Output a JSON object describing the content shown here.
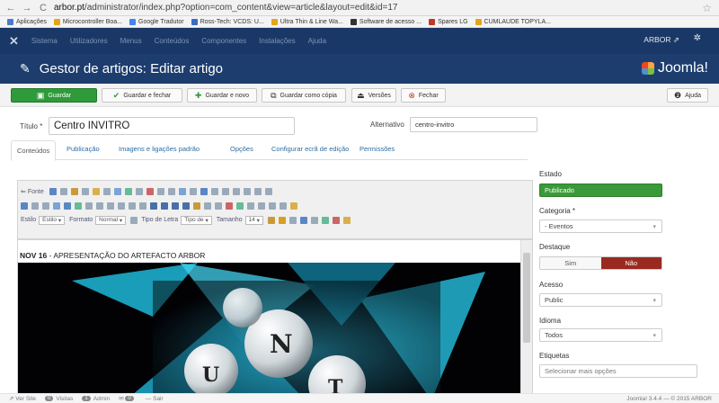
{
  "browser": {
    "url_prefix": "arbor.pt",
    "url_rest": "/administrator/index.php?option=com_content&view=article&layout=edit&id=17",
    "bookmarks": [
      {
        "label": "Aplicações",
        "color": "#4a7bd0"
      },
      {
        "label": "Microcontroller Boa...",
        "color": "#e6a419"
      },
      {
        "label": "Google Tradutor",
        "color": "#4285f4"
      },
      {
        "label": "Ross-Tech: VCDS: U...",
        "color": "#3b6cc4"
      },
      {
        "label": "Ultra Thin & Line Wa...",
        "color": "#e6a419"
      },
      {
        "label": "Software de acesso ...",
        "color": "#333333"
      },
      {
        "label": "Spares LG",
        "color": "#c0392b"
      },
      {
        "label": "CUMLAUDE TOPYLA...",
        "color": "#e6a419"
      }
    ]
  },
  "topnav": {
    "items": [
      "Sistema",
      "Utilizadores",
      "Menus",
      "Conteúdos",
      "Componentes",
      "Instalações",
      "Ajuda"
    ],
    "user": "ARBOR ⇗"
  },
  "header": {
    "title": "Gestor de artigos: Editar artigo",
    "logo": "Joomla!"
  },
  "toolbar": {
    "save": "Guardar",
    "save_close": "Guardar e fechar",
    "save_new": "Guardar e novo",
    "save_copy": "Guardar como cópia",
    "versions": "Versões",
    "close": "Fechar",
    "help": "Ajuda"
  },
  "form": {
    "title_label": "Título *",
    "title_value": "Centro INVITRO",
    "alias_label": "Alternativo",
    "alias_value": "centro-invitro"
  },
  "tabs": [
    "Conteúdos",
    "Publicação",
    "Imagens e ligações padrão",
    "Opções",
    "Configurar ecrã de edição",
    "Permissões"
  ],
  "editor": {
    "row1_label": "Fonte",
    "style_label": "Estilo",
    "style_value": "Estilo",
    "format_label": "Formato",
    "format_value": "Normal",
    "font_label": "Tipo de Letra",
    "font_value": "Tipo de",
    "size_label": "Tamanho",
    "size_value": "14",
    "heading_bold": "NOV 16",
    "heading_rest": " - APRESENTAÇÃO DO ARTEFACTO ARBOR"
  },
  "sidebar": {
    "estado_label": "Estado",
    "estado_value": "Publicado",
    "categoria_label": "Categoria *",
    "categoria_value": "- Eventos",
    "destaque_label": "Destaque",
    "sim": "Sim",
    "nao": "Não",
    "acesso_label": "Acesso",
    "acesso_value": "Public",
    "idioma_label": "Idioma",
    "idioma_value": "Todos",
    "etiquetas_label": "Etiquetas",
    "etiquetas_placeholder": "Selecionar mais opções"
  },
  "status": {
    "ver_site": "Ver Site",
    "visitas": "Visitas",
    "visitas_count": "0",
    "admin": "Admin",
    "admin_count": "1",
    "mail_count": "0",
    "sair": "Sair",
    "version": "Joomla! 3.4.4 — © 2015 ARBOR"
  },
  "colors": {
    "nav_bg": "#1a3867",
    "header_bg": "#1c3d6e",
    "save_green": "#2f9a3a",
    "published_green": "#3a9a3a",
    "nao_red": "#9a2a20"
  }
}
